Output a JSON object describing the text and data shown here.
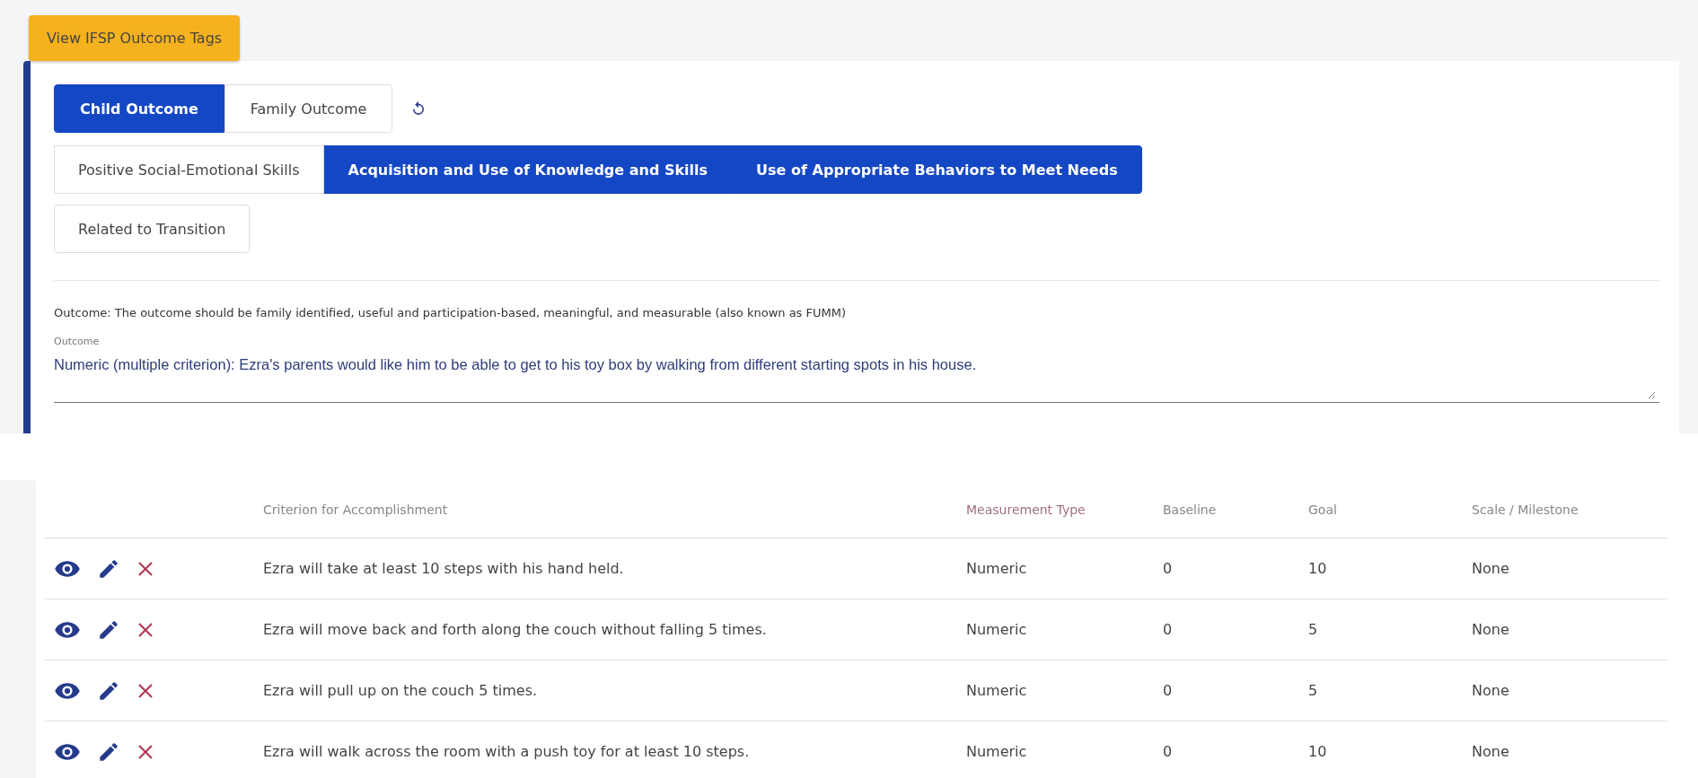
{
  "tags_button": "View IFSP Outcome Tags",
  "outcome_tabs": [
    {
      "label": "Child Outcome",
      "selected": true
    },
    {
      "label": "Family Outcome",
      "selected": false
    }
  ],
  "category_tabs": [
    {
      "label": "Positive Social-Emotional Skills",
      "selected": false
    },
    {
      "label": "Acquisition and Use of Knowledge and Skills",
      "selected": true
    },
    {
      "label": "Use of Appropriate Behaviors to Meet Needs",
      "selected": true
    },
    {
      "label": "Related to Transition",
      "selected": false
    }
  ],
  "guidance": "Outcome: The outcome should be family identified, useful and participation-based, meaningful, and measurable (also known as FUMM)",
  "outcome_field": {
    "label": "Outcome",
    "value": "Numeric (multiple criterion): Ezra's parents would like him to be able to get to his toy box by walking from different starting spots in his house."
  },
  "table": {
    "columns": [
      "Criterion for Accomplishment",
      "Measurement Type",
      "Baseline",
      "Goal",
      "Scale / Milestone"
    ],
    "rows": [
      {
        "criterion": "Ezra will take at least 10 steps with his hand held.",
        "measurement_type": "Numeric",
        "baseline": "0",
        "goal": "10",
        "scale": "None"
      },
      {
        "criterion": "Ezra will move back and forth along the couch without falling 5 times.",
        "measurement_type": "Numeric",
        "baseline": "0",
        "goal": "5",
        "scale": "None"
      },
      {
        "criterion": "Ezra will pull up on the couch 5 times.",
        "measurement_type": "Numeric",
        "baseline": "0",
        "goal": "5",
        "scale": "None"
      },
      {
        "criterion": "Ezra will walk across the room with a push toy for at least 10 steps.",
        "measurement_type": "Numeric",
        "baseline": "0",
        "goal": "10",
        "scale": "None"
      }
    ]
  }
}
